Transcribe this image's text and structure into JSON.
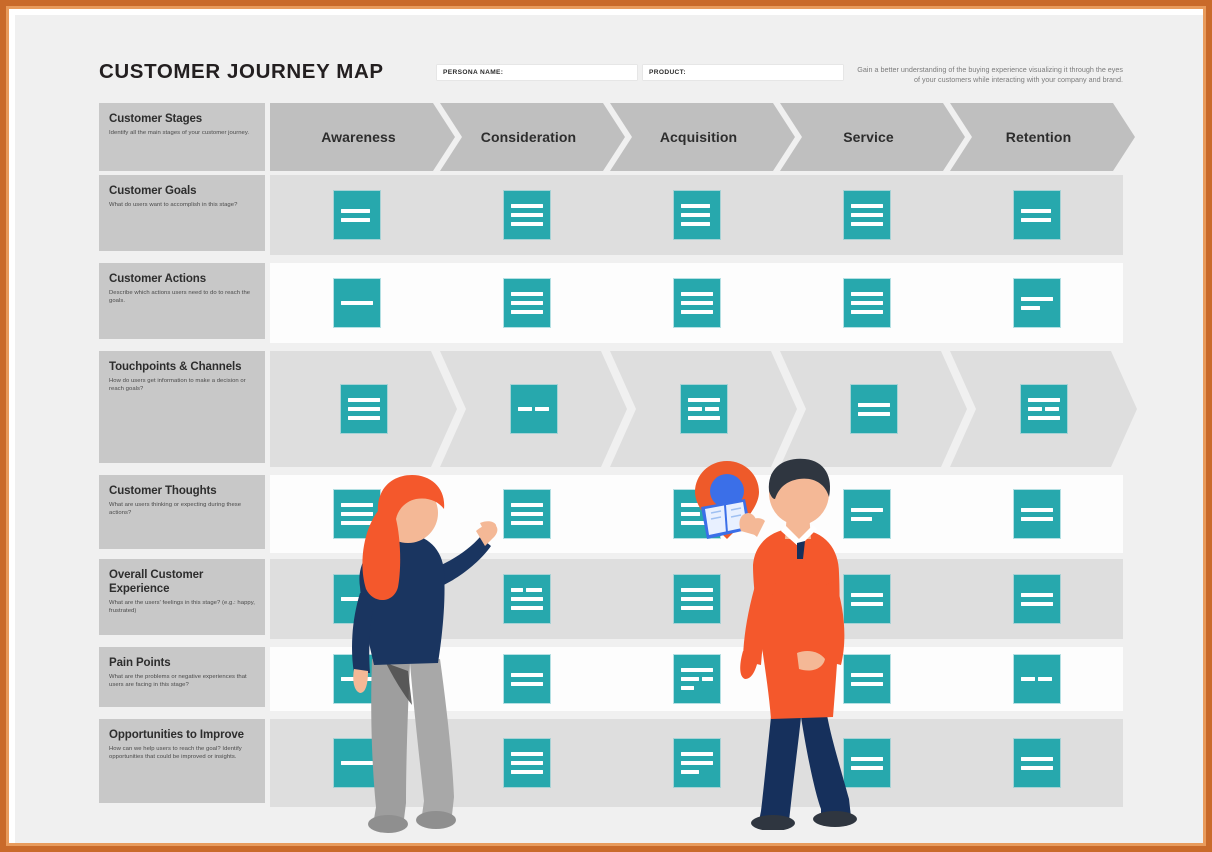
{
  "title": "CUSTOMER JOURNEY MAP",
  "header": {
    "persona_label": "PERSONA NAME:",
    "product_label": "PRODUCT:",
    "description": "Gain a better understanding of the buying experience visualizing it through the eyes of your customers while interacting with your company and brand.",
    "persona_value": "",
    "product_value": ""
  },
  "colors": {
    "teal": "#27a8ad",
    "stage_gray": "#bfbfbf",
    "label_gray": "#c8c8c8",
    "row_gray": "#dedede",
    "row_white": "#fdfdfd",
    "canvas": "#f0f0f0",
    "orange": "#f4582c",
    "navy": "#1a3560",
    "frame": "#c96a2a"
  },
  "stages": [
    {
      "label": "Awareness"
    },
    {
      "label": "Consideration"
    },
    {
      "label": "Acquisition"
    },
    {
      "label": "Service"
    },
    {
      "label": "Retention"
    }
  ],
  "rows": [
    {
      "id": "customer-stages",
      "title": "Customer Stages",
      "subtitle": "Identify all the main stages of your customer journey.",
      "background": "none",
      "kind": "stages"
    },
    {
      "id": "customer-goals",
      "title": "Customer Goals",
      "subtitle": "What do users want to accomplish in this stage?",
      "background": "gray",
      "kind": "cards",
      "cards": [
        {
          "lines": [
            [
              36
            ],
            [
              36
            ]
          ]
        },
        {
          "lines": [
            [
              40
            ],
            [
              40
            ],
            [
              40
            ]
          ]
        },
        {
          "lines": [
            [
              36
            ],
            [
              36
            ],
            [
              36
            ]
          ]
        },
        {
          "lines": [
            [
              40
            ],
            [
              40
            ],
            [
              40
            ]
          ]
        },
        {
          "lines": [
            [
              38
            ],
            [
              38
            ]
          ]
        }
      ]
    },
    {
      "id": "customer-actions",
      "title": "Customer Actions",
      "subtitle": "Describe which actions users need to do to reach the goals.",
      "background": "white",
      "kind": "cards",
      "cards": [
        {
          "lines": [
            [
              40
            ]
          ]
        },
        {
          "lines": [
            [
              40
            ],
            [
              40
            ],
            [
              40
            ]
          ]
        },
        {
          "lines": [
            [
              40
            ],
            [
              40
            ],
            [
              40
            ]
          ]
        },
        {
          "lines": [
            [
              40
            ],
            [
              40
            ],
            [
              40
            ]
          ]
        },
        {
          "lines": [
            [
              40
            ],
            [
              24
            ]
          ]
        }
      ]
    },
    {
      "id": "touchpoints-channels",
      "title": "Touchpoints & Channels",
      "subtitle": "How do users get information to make a decision or reach goals?",
      "background": "chevron",
      "kind": "cards",
      "cards": [
        {
          "lines": [
            [
              40
            ],
            [
              40
            ],
            [
              40
            ]
          ]
        },
        {
          "lines": [
            [
              17,
              17
            ]
          ]
        },
        {
          "lines": [
            [
              40
            ],
            [
              18,
              18
            ],
            [
              40
            ]
          ]
        },
        {
          "lines": [
            [
              40
            ],
            [
              40
            ]
          ]
        },
        {
          "lines": [
            [
              40
            ],
            [
              18,
              18
            ],
            [
              40
            ]
          ]
        }
      ]
    },
    {
      "id": "customer-thoughts",
      "title": "Customer Thoughts",
      "subtitle": "What are users thinking or expecting during these actions?",
      "background": "white",
      "kind": "cards",
      "cards": [
        {
          "lines": [
            [
              40
            ],
            [
              40
            ],
            [
              40
            ]
          ]
        },
        {
          "lines": [
            [
              40
            ],
            [
              40
            ],
            [
              40
            ]
          ]
        },
        {
          "lines": [
            [
              40
            ],
            [
              24
            ],
            [
              40
            ]
          ]
        },
        {
          "lines": [
            [
              40
            ],
            [
              26
            ]
          ]
        },
        {
          "lines": [
            [
              40
            ],
            [
              40
            ]
          ]
        }
      ]
    },
    {
      "id": "overall-customer-experience",
      "title": "Overall Customer Experience",
      "subtitle": "What are the users' feelings in this stage? (e.g.: happy, frustrated)",
      "background": "gray",
      "kind": "cards",
      "cards": [
        {
          "lines": [
            [
              40
            ]
          ]
        },
        {
          "lines": [
            [
              15,
              20
            ],
            [
              40
            ],
            [
              40
            ]
          ]
        },
        {
          "lines": [
            [
              40
            ],
            [
              40
            ],
            [
              40
            ]
          ]
        },
        {
          "lines": [
            [
              40
            ],
            [
              40
            ]
          ]
        },
        {
          "lines": [
            [
              40
            ],
            [
              40
            ]
          ]
        }
      ]
    },
    {
      "id": "pain-points",
      "title": "Pain Points",
      "subtitle": "What are the problems or negative experiences that users are facing in this stage?",
      "background": "white",
      "kind": "cards",
      "cards": [
        {
          "lines": [
            [
              40
            ]
          ]
        },
        {
          "lines": [
            [
              40
            ],
            [
              40
            ]
          ]
        },
        {
          "lines": [
            [
              40
            ],
            [
              22,
              14
            ],
            [
              16
            ]
          ]
        },
        {
          "lines": [
            [
              40
            ],
            [
              40
            ]
          ]
        },
        {
          "lines": [
            [
              18,
              18
            ]
          ]
        }
      ]
    },
    {
      "id": "opportunities-to-improve",
      "title": "Opportunities to Improve",
      "subtitle": "How can we help users to reach the goal? Identify opportunities that could be improved or insights.",
      "background": "gray",
      "kind": "cards",
      "cards": [
        {
          "lines": [
            [
              40
            ]
          ]
        },
        {
          "lines": [
            [
              40
            ],
            [
              40
            ],
            [
              40
            ]
          ]
        },
        {
          "lines": [
            [
              40
            ],
            [
              40
            ],
            [
              22
            ]
          ]
        },
        {
          "lines": [
            [
              40
            ],
            [
              40
            ]
          ]
        },
        {
          "lines": [
            [
              40
            ],
            [
              40
            ]
          ]
        }
      ]
    }
  ],
  "illustrations": {
    "woman": {
      "name": "woman-pointing",
      "hair": "#f4582c",
      "top": "#1a3560",
      "pants": "#9e9e9e",
      "skin": "#f4b896",
      "shoes": "#9e9e9e"
    },
    "man": {
      "name": "man-holding-map",
      "hair": "#2f3640",
      "sweater": "#f4582c",
      "pants": "#16305c",
      "skin": "#f4b896",
      "shoes": "#2f3640"
    },
    "pin": {
      "name": "location-pin",
      "outer": "#ee5a2a",
      "inner": "#3b6fe8"
    },
    "map": {
      "name": "folded-map",
      "primary": "#3b6fe8",
      "paper": "#e8f0ff"
    }
  }
}
